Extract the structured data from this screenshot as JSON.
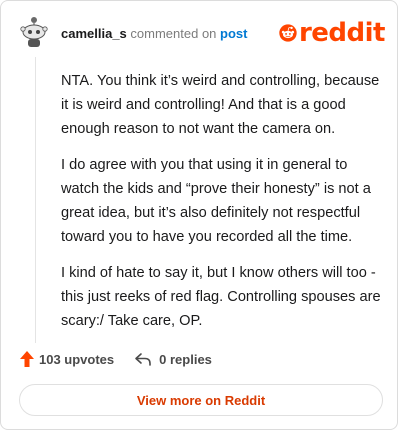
{
  "header": {
    "username": "camellia_s",
    "action": "commented on",
    "post_link": "post",
    "brand": "reddit"
  },
  "comment": {
    "paragraphs": [
      "NTA. You think it’s weird and controlling, because it is weird and controlling! And that is a good enough reason to not want the camera on.",
      "I do agree with you that using it in general to watch the kids and “prove their honesty” is not a great idea, but it’s also definitely not respectful toward you to have you recorded all the time.",
      "I kind of hate to say it, but I know others will too - this just reeks of red flag. Controlling spouses are scary:/ Take care, OP."
    ]
  },
  "footer": {
    "upvotes": "103 upvotes",
    "replies": "0 replies"
  },
  "cta": {
    "label": "View more on Reddit"
  },
  "colors": {
    "brand_orange": "#ff4500",
    "upvote_orange": "#ff4500",
    "cta_text": "#d93a00",
    "link_blue": "#0079d3"
  },
  "icons": {
    "avatar": "snoo-avatar-icon",
    "logo": "reddit-snoo-icon",
    "upvote": "upvote-arrow-icon",
    "reply": "reply-arrow-icon"
  }
}
